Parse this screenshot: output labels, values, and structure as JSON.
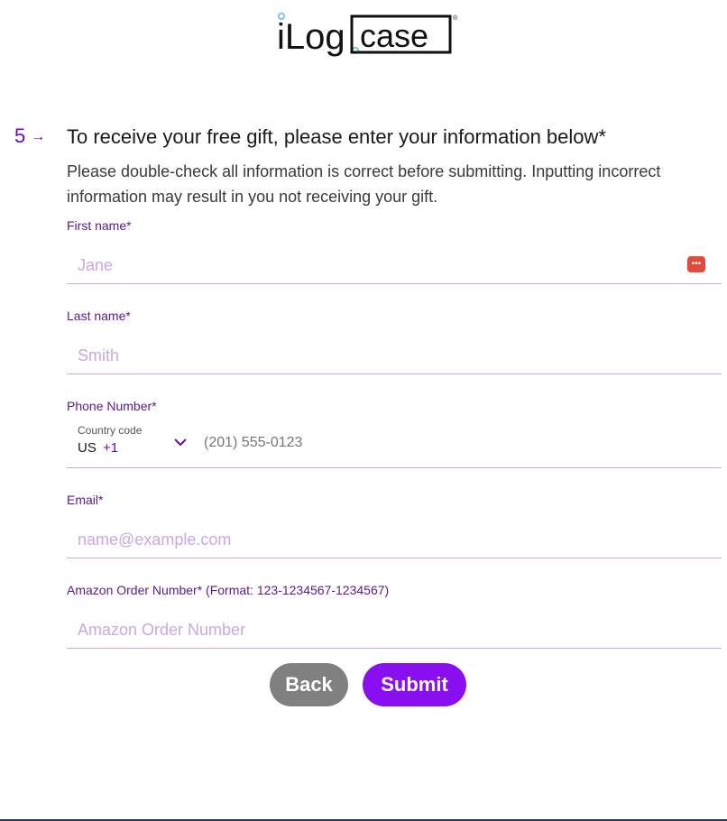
{
  "logo": {
    "text": "iLogicase"
  },
  "question": {
    "number": "5",
    "title": "To receive your free gift, please enter your information below*",
    "description": "Please double-check all information is correct before submitting. Inputting incorrect information may result in you not receiving your gift."
  },
  "fields": {
    "first_name": {
      "label": "First name*",
      "placeholder": "Jane",
      "value": ""
    },
    "last_name": {
      "label": "Last name*",
      "placeholder": "Smith",
      "value": ""
    },
    "phone": {
      "label": "Phone Number*",
      "country_code_label": "Country code",
      "country_code_value": "US",
      "dial_code": "+1",
      "placeholder": "(201) 555-0123",
      "value": ""
    },
    "email": {
      "label": "Email*",
      "placeholder": "name@example.com",
      "value": ""
    },
    "amazon_order": {
      "label": "Amazon Order Number* (Format: 123-1234567-1234567)",
      "placeholder": "Amazon Order Number",
      "value": ""
    }
  },
  "buttons": {
    "back": "Back",
    "submit": "Submit"
  },
  "colors": {
    "accent": "#8a0ff0",
    "label": "#5b1a8a",
    "placeholder": "#c7a9e6",
    "back_button": "#808080"
  },
  "icons": {
    "password_manager": "password-dots-icon",
    "chevron": "chevron-down-icon",
    "arrow": "arrow-right-icon"
  }
}
